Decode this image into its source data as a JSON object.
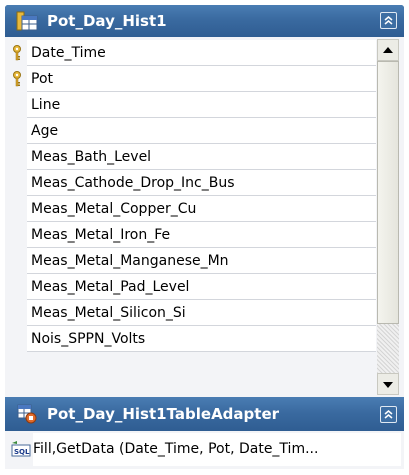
{
  "table": {
    "title": "Pot_Day_Hist1",
    "columns": [
      {
        "name": "Date_Time",
        "is_key": true
      },
      {
        "name": "Pot",
        "is_key": true
      },
      {
        "name": "Line",
        "is_key": false
      },
      {
        "name": "Age",
        "is_key": false
      },
      {
        "name": "Meas_Bath_Level",
        "is_key": false
      },
      {
        "name": "Meas_Cathode_Drop_Inc_Bus",
        "is_key": false
      },
      {
        "name": "Meas_Metal_Copper_Cu",
        "is_key": false
      },
      {
        "name": "Meas_Metal_Iron_Fe",
        "is_key": false
      },
      {
        "name": "Meas_Metal_Manganese_Mn",
        "is_key": false
      },
      {
        "name": "Meas_Metal_Pad_Level",
        "is_key": false
      },
      {
        "name": "Meas_Metal_Silicon_Si",
        "is_key": false
      },
      {
        "name": "Nois_SPPN_Volts",
        "is_key": false
      }
    ]
  },
  "adapter": {
    "title": "Pot_Day_Hist1TableAdapter",
    "methods": [
      "Fill,GetData (Date_Time, Pot, Date_Tim..."
    ]
  },
  "icons": {
    "table": "table-icon",
    "adapter": "table-adapter-icon",
    "key": "primary-key-icon",
    "query": "sql-query-icon",
    "collapse": "collapse-chevron-icon"
  },
  "colors": {
    "header": "#3a6aa0",
    "border": "#2c6096",
    "key": "#e8b93c"
  }
}
